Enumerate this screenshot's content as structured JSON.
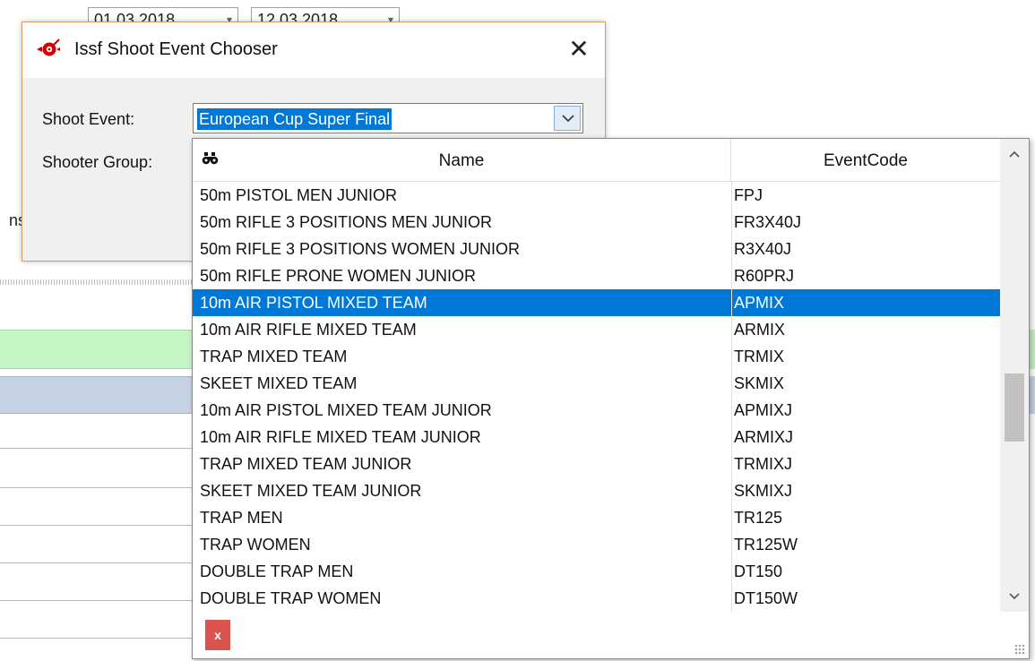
{
  "background": {
    "date_from": "01.03.2018",
    "date_to": "12.03.2018",
    "partial_label": "ns"
  },
  "dialog": {
    "title": "Issf Shoot Event Chooser",
    "close_glyph": "✕",
    "shoot_event_label": "Shoot Event:",
    "shooter_group_label": "Shooter Group:",
    "shoot_event_value": "European Cup Super Final"
  },
  "dropdown": {
    "columns": {
      "name": "Name",
      "code": "EventCode"
    },
    "selected_index": 4,
    "rows": [
      {
        "name": "50m PISTOL MEN JUNIOR",
        "code": "FPJ"
      },
      {
        "name": "50m RIFLE 3 POSITIONS MEN JUNIOR",
        "code": "FR3X40J"
      },
      {
        "name": "50m RIFLE 3 POSITIONS WOMEN JUNIOR",
        "code": "R3X40J"
      },
      {
        "name": "50m RIFLE PRONE WOMEN JUNIOR",
        "code": "R60PRJ"
      },
      {
        "name": "10m AIR PISTOL MIXED TEAM",
        "code": "APMIX"
      },
      {
        "name": "10m AIR RIFLE MIXED TEAM",
        "code": "ARMIX"
      },
      {
        "name": "TRAP MIXED TEAM",
        "code": "TRMIX"
      },
      {
        "name": "SKEET MIXED TEAM",
        "code": "SKMIX"
      },
      {
        "name": "10m AIR PISTOL MIXED TEAM JUNIOR",
        "code": "APMIXJ"
      },
      {
        "name": "10m AIR RIFLE MIXED TEAM JUNIOR",
        "code": "ARMIXJ"
      },
      {
        "name": "TRAP MIXED TEAM JUNIOR",
        "code": "TRMIXJ"
      },
      {
        "name": "SKEET MIXED TEAM JUNIOR",
        "code": "SKMIXJ"
      },
      {
        "name": "TRAP MEN",
        "code": "TR125"
      },
      {
        "name": "TRAP WOMEN",
        "code": "TR125W"
      },
      {
        "name": "DOUBLE TRAP MEN",
        "code": "DT150"
      },
      {
        "name": "DOUBLE TRAP WOMEN",
        "code": "DT150W"
      }
    ],
    "clear_label": "x"
  },
  "colors": {
    "selection": "#0078d7",
    "clear_button": "#d9534f",
    "dialog_border": "#d49b63"
  }
}
